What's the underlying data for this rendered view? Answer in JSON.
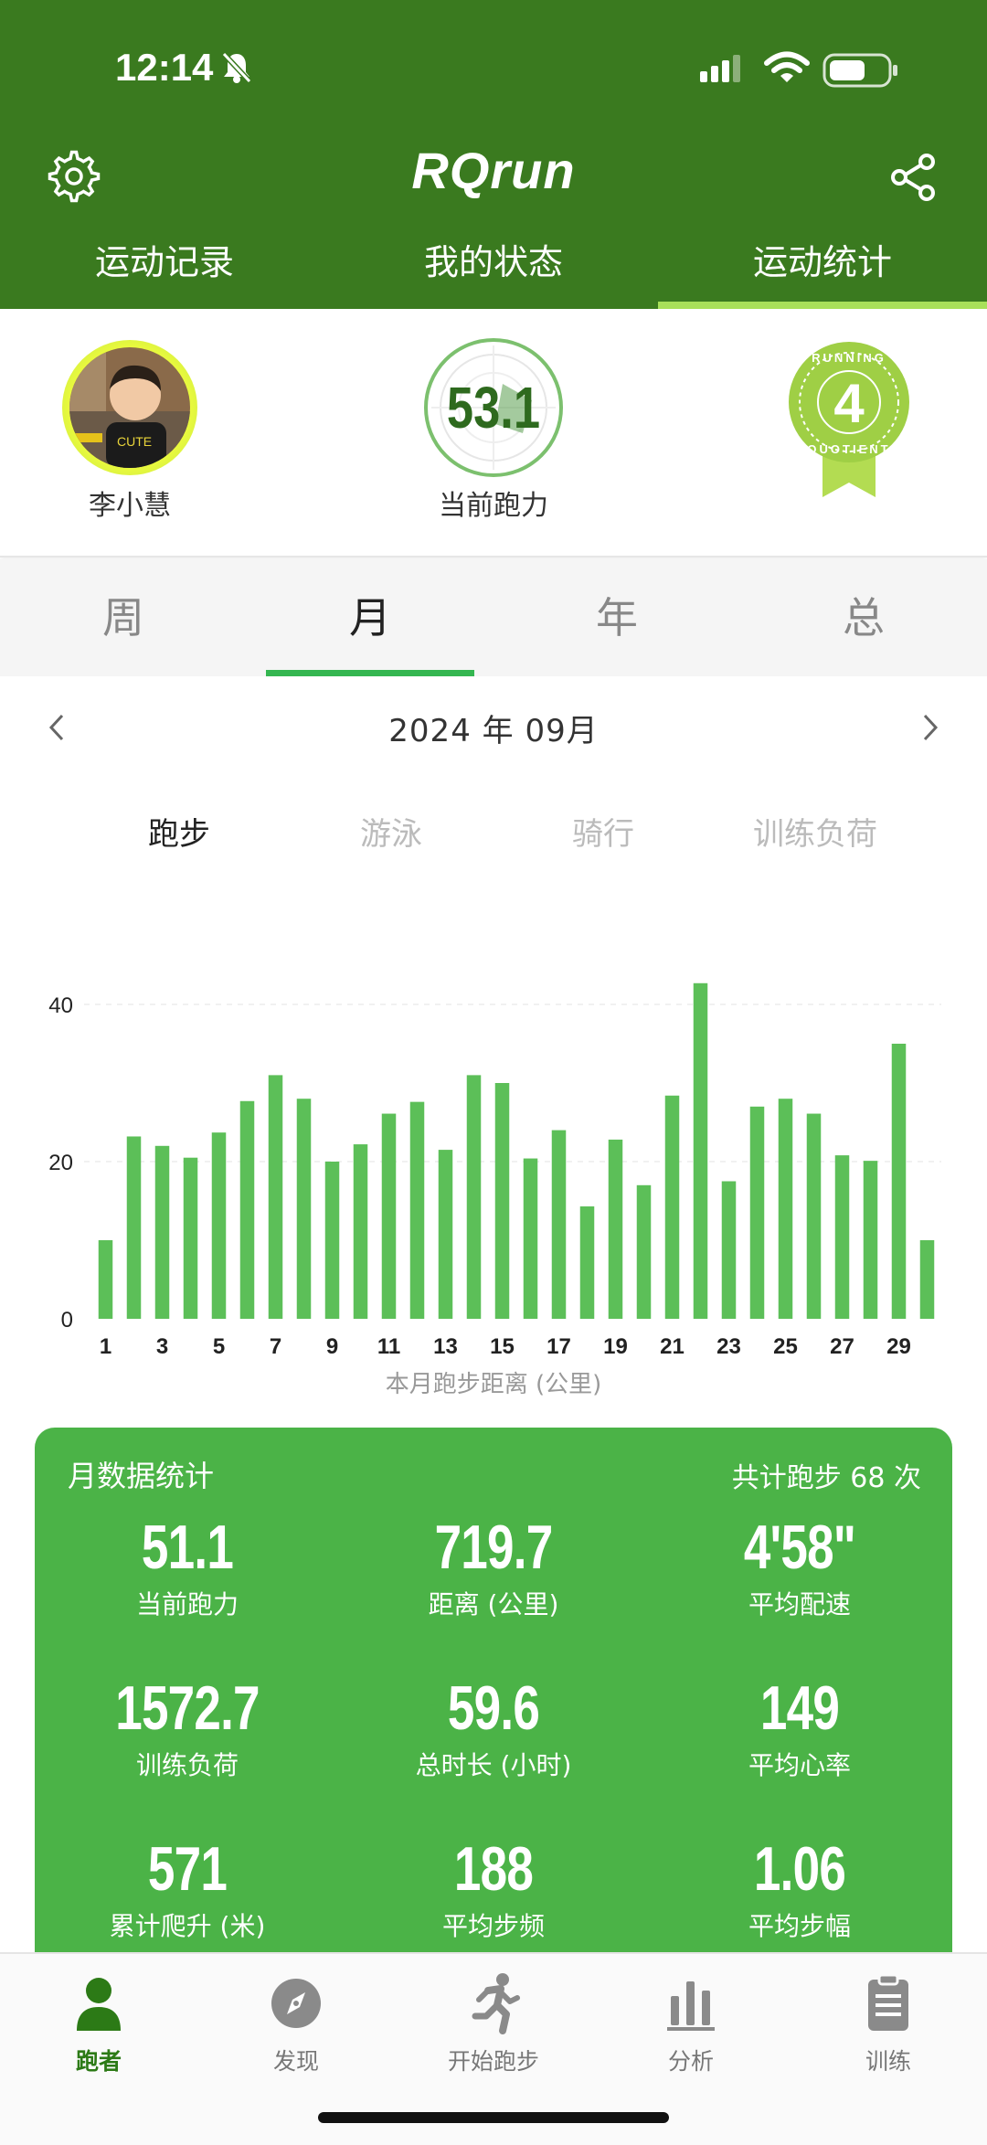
{
  "status_bar": {
    "time": "12:14"
  },
  "header": {
    "title": "RQrun",
    "tabs": [
      {
        "label": "运动记录",
        "active": false
      },
      {
        "label": "我的状态",
        "active": false
      },
      {
        "label": "运动统计",
        "active": true
      }
    ]
  },
  "profile": {
    "user_name": "李小慧",
    "current_power_value": "53.1",
    "current_power_label": "当前跑力",
    "medal_number": "4",
    "medal_text": "RUNNING QUOTIENT"
  },
  "period_tabs": [
    {
      "label": "周",
      "active": false
    },
    {
      "label": "月",
      "active": true
    },
    {
      "label": "年",
      "active": false
    },
    {
      "label": "总",
      "active": false
    }
  ],
  "month_label": "2024 年 09月",
  "sport_tabs": [
    {
      "label": "跑步",
      "active": true
    },
    {
      "label": "游泳",
      "active": false
    },
    {
      "label": "骑行",
      "active": false
    },
    {
      "label": "训练负荷",
      "active": false
    }
  ],
  "chart_data": {
    "type": "bar",
    "caption": "本月跑步距离 (公里)",
    "categories": [
      "1",
      "2",
      "3",
      "4",
      "5",
      "6",
      "7",
      "8",
      "9",
      "10",
      "11",
      "12",
      "13",
      "14",
      "15",
      "16",
      "17",
      "18",
      "19",
      "20",
      "21",
      "22",
      "23",
      "24",
      "25",
      "26",
      "27",
      "28",
      "29",
      "30"
    ],
    "x_tick_labels": [
      "1",
      "3",
      "5",
      "7",
      "9",
      "11",
      "13",
      "15",
      "17",
      "19",
      "21",
      "23",
      "25",
      "27",
      "29"
    ],
    "values": [
      10,
      23.2,
      22,
      20.5,
      23.7,
      27.7,
      31,
      28,
      20,
      22.2,
      26.1,
      27.6,
      21.5,
      31,
      30,
      20.4,
      24,
      14.3,
      22.8,
      17,
      28.4,
      42.7,
      17.5,
      27,
      28,
      26.1,
      20.8,
      20.1,
      35,
      10
    ],
    "y_ticks": [
      0,
      20,
      40
    ],
    "ylim": [
      0,
      45
    ],
    "color": "#5cbf58"
  },
  "stats_card": {
    "title": "月数据统计",
    "total_label": "共计跑步 68 次",
    "items": [
      {
        "value": "51.1",
        "label": "当前跑力"
      },
      {
        "value": "719.7",
        "label": "距离 (公里)"
      },
      {
        "value": "4'58\"",
        "label": "平均配速"
      },
      {
        "value": "1572.7",
        "label": "训练负荷"
      },
      {
        "value": "59.6",
        "label": "总时长 (小时)"
      },
      {
        "value": "149",
        "label": "平均心率"
      },
      {
        "value": "571",
        "label": "累计爬升 (米)"
      },
      {
        "value": "188",
        "label": "平均步频"
      },
      {
        "value": "1.06",
        "label": "平均步幅"
      }
    ]
  },
  "bottom_nav": [
    {
      "label": "跑者",
      "icon": "user-icon",
      "active": true
    },
    {
      "label": "发现",
      "icon": "compass-icon",
      "active": false
    },
    {
      "label": "开始跑步",
      "icon": "runner-icon",
      "active": false
    },
    {
      "label": "分析",
      "icon": "bar-chart-icon",
      "active": false
    },
    {
      "label": "训练",
      "icon": "clipboard-icon",
      "active": false
    }
  ],
  "colors": {
    "header_green": "#3a7a1f",
    "card_green": "#4bb347",
    "accent_lime": "#a8e05a",
    "bar_green": "#5cbf58"
  }
}
